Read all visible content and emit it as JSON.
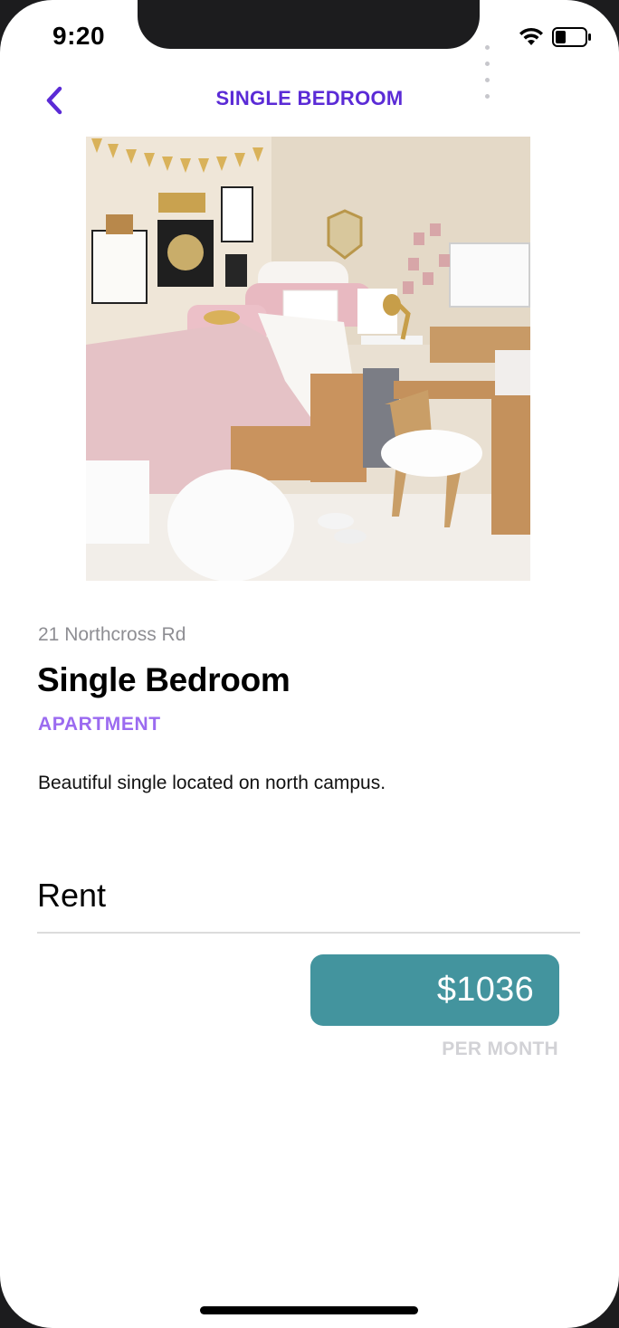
{
  "status_bar": {
    "time": "9:20"
  },
  "nav": {
    "title": "SINGLE BEDROOM",
    "back_icon": "chevron-left-icon"
  },
  "listing": {
    "address": "21 Northcross Rd",
    "title": "Single Bedroom",
    "category": "APARTMENT",
    "description": "Beautiful single located on north campus."
  },
  "rent": {
    "heading": "Rent",
    "price": "$1036",
    "period": "PER MONTH"
  },
  "colors": {
    "accent": "#5b2bd6",
    "category": "#9b6bf0",
    "price_pill": "#43949e"
  }
}
